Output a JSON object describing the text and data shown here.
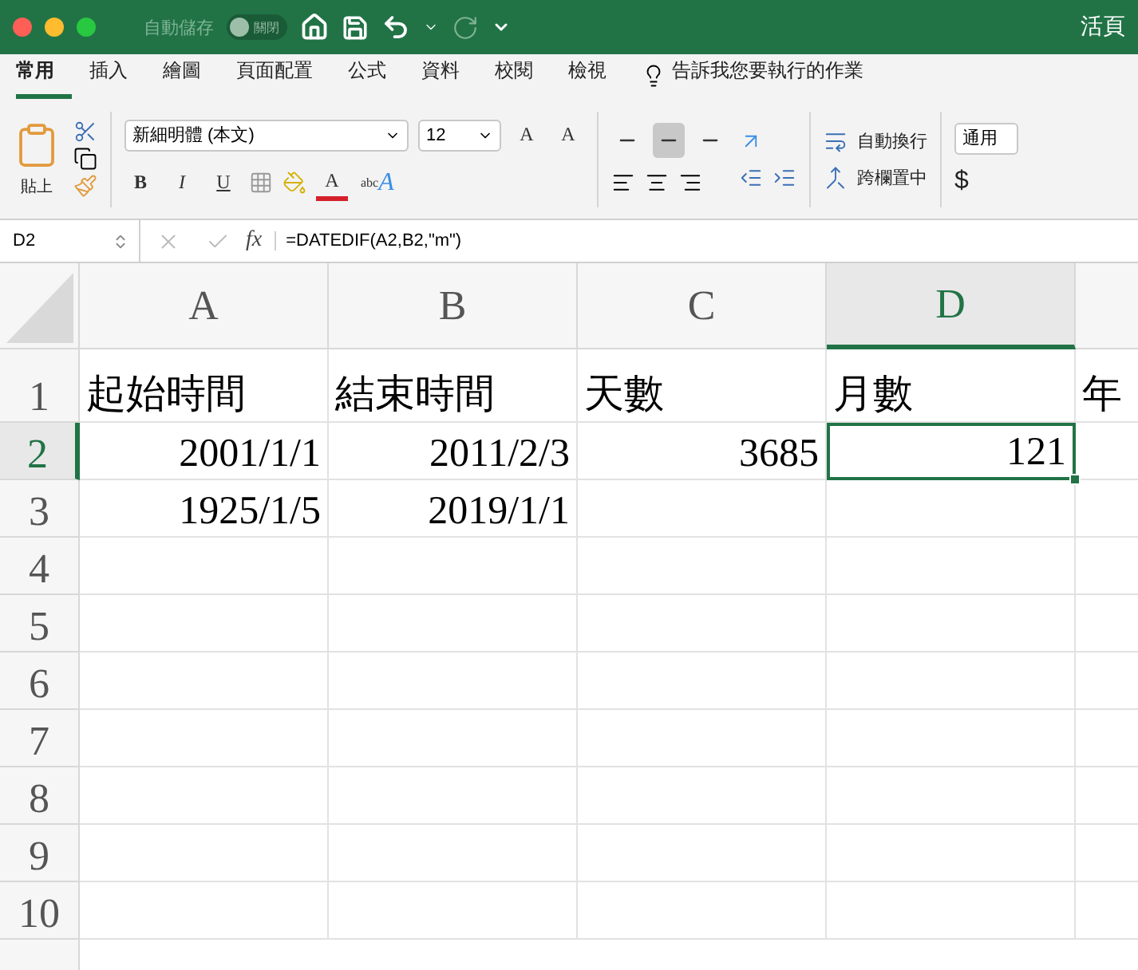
{
  "window": {
    "title": "活頁",
    "autosave_label": "自動儲存",
    "autosave_toggle": {
      "label": "關閉",
      "on": false
    }
  },
  "tabs": [
    {
      "label": "常用",
      "selected": true
    },
    {
      "label": "插入",
      "selected": false
    },
    {
      "label": "繪圖",
      "selected": false
    },
    {
      "label": "頁面配置",
      "selected": false
    },
    {
      "label": "公式",
      "selected": false
    },
    {
      "label": "資料",
      "selected": false
    },
    {
      "label": "校閱",
      "selected": false
    },
    {
      "label": "檢視",
      "selected": false
    }
  ],
  "tell_me": "告訴我您要執行的作業",
  "ribbon": {
    "paste_label": "貼上",
    "font_name": "新細明體 (本文)",
    "font_size": "12",
    "size_buttons": [
      "A",
      "A"
    ],
    "style_buttons": [
      "B",
      "I",
      "U"
    ],
    "font_color_label": "A",
    "text_effects": [
      "abc",
      "A"
    ],
    "vertical_align": [
      {
        "selected": false
      },
      {
        "selected": true
      },
      {
        "selected": false
      }
    ],
    "wrap_text": "自動換行",
    "merge": "跨欄置中",
    "number_format": "通用",
    "currency": "$"
  },
  "formula_bar": {
    "name_box": "D2",
    "fx": "fx",
    "formula": "=DATEDIF(A2,B2,\"m\")"
  },
  "columns": [
    {
      "label": "A",
      "selected": false
    },
    {
      "label": "B",
      "selected": false
    },
    {
      "label": "C",
      "selected": false
    },
    {
      "label": "D",
      "selected": true
    }
  ],
  "rows": [
    {
      "label": "1",
      "selected": false,
      "cells": [
        {
          "value": "起始時間",
          "kind": "text",
          "selected": false
        },
        {
          "value": "結束時間",
          "kind": "text",
          "selected": false
        },
        {
          "value": "天數",
          "kind": "text",
          "selected": false
        },
        {
          "value": "月數",
          "kind": "text",
          "selected": false
        },
        {
          "value": "年",
          "kind": "text",
          "selected": false
        }
      ]
    },
    {
      "label": "2",
      "selected": true,
      "cells": [
        {
          "value": "2001/1/1",
          "kind": "number",
          "selected": false
        },
        {
          "value": "2011/2/3",
          "kind": "number",
          "selected": false
        },
        {
          "value": "3685",
          "kind": "number",
          "selected": false
        },
        {
          "value": "121",
          "kind": "number",
          "selected": true
        }
      ]
    },
    {
      "label": "3",
      "selected": false,
      "cells": [
        {
          "value": "1925/1/5",
          "kind": "number",
          "selected": false
        },
        {
          "value": "2019/1/1",
          "kind": "number",
          "selected": false
        }
      ]
    },
    {
      "label": "4",
      "selected": false
    },
    {
      "label": "5",
      "selected": false
    },
    {
      "label": "6",
      "selected": false
    },
    {
      "label": "7",
      "selected": false
    },
    {
      "label": "8",
      "selected": false
    },
    {
      "label": "9",
      "selected": false
    },
    {
      "label": "10",
      "selected": false
    }
  ]
}
